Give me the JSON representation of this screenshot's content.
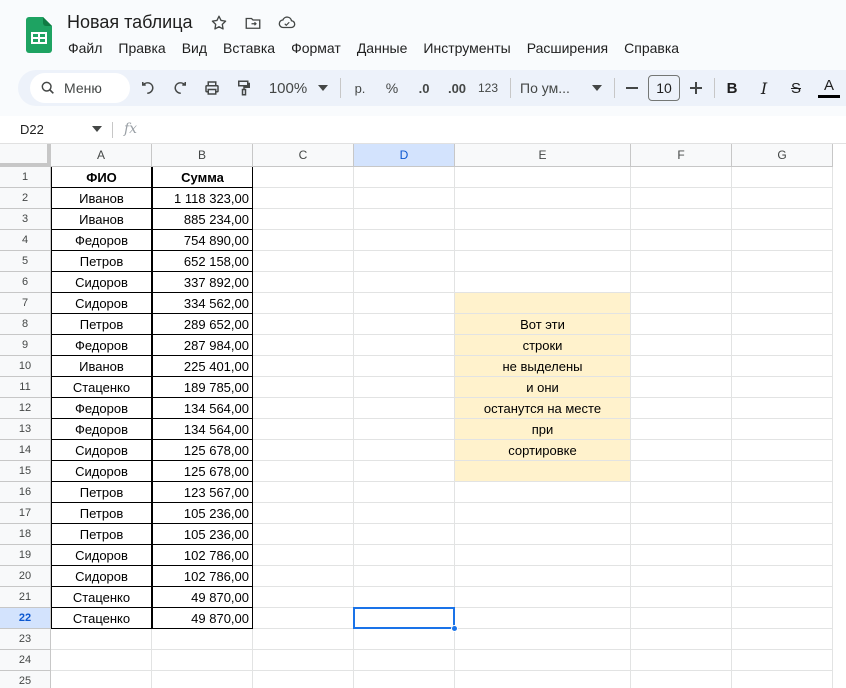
{
  "doc": {
    "title": "Новая таблица",
    "icons": [
      "star-icon",
      "move-to-folder-icon",
      "cloud-status-icon"
    ]
  },
  "menu": [
    "Файл",
    "Правка",
    "Вид",
    "Вставка",
    "Формат",
    "Данные",
    "Инструменты",
    "Расширения",
    "Справка"
  ],
  "toolbar": {
    "search_label": "Меню",
    "zoom": "100%",
    "currency": "р.",
    "percent": "%",
    "decrease_decimals": ".0",
    "increase_decimals": ".00",
    "number_format": "123",
    "font_name": "По ум...",
    "font_size": "10",
    "bold": "B",
    "italic": "I",
    "strike": "S",
    "text_color": "A"
  },
  "formula_bar": {
    "name_box": "D22",
    "fx": "fx",
    "content": ""
  },
  "columns": [
    "A",
    "B",
    "C",
    "D",
    "E",
    "F",
    "G"
  ],
  "active_column": "D",
  "active_row": 22,
  "rows": [
    "1",
    "2",
    "3",
    "4",
    "5",
    "6",
    "7",
    "8",
    "9",
    "10",
    "11",
    "12",
    "13",
    "14",
    "15",
    "16",
    "17",
    "18",
    "19",
    "20",
    "21",
    "22",
    "23",
    "24",
    "25"
  ],
  "table": {
    "header": {
      "name": "ФИО",
      "amount": "Сумма"
    },
    "data": [
      {
        "name": "Иванов",
        "amount": "1 118 323,00"
      },
      {
        "name": "Иванов",
        "amount": "885 234,00"
      },
      {
        "name": "Федоров",
        "amount": "754 890,00"
      },
      {
        "name": "Петров",
        "amount": "652 158,00"
      },
      {
        "name": "Сидоров",
        "amount": "337 892,00"
      },
      {
        "name": "Сидоров",
        "amount": "334 562,00"
      },
      {
        "name": "Петров",
        "amount": "289 652,00"
      },
      {
        "name": "Федоров",
        "amount": "287 984,00"
      },
      {
        "name": "Иванов",
        "amount": "225 401,00"
      },
      {
        "name": "Стаценко",
        "amount": "189 785,00"
      },
      {
        "name": "Федоров",
        "amount": "134 564,00"
      },
      {
        "name": "Федоров",
        "amount": "134 564,00"
      },
      {
        "name": "Сидоров",
        "amount": "125 678,00"
      },
      {
        "name": "Сидоров",
        "amount": "125 678,00"
      },
      {
        "name": "Петров",
        "amount": "123 567,00"
      },
      {
        "name": "Петров",
        "amount": "105 236,00"
      },
      {
        "name": "Петров",
        "amount": "105 236,00"
      },
      {
        "name": "Сидоров",
        "amount": "102 786,00"
      },
      {
        "name": "Сидоров",
        "amount": "102 786,00"
      },
      {
        "name": "Стаценко",
        "amount": "49 870,00"
      },
      {
        "name": "Стаценко",
        "amount": "49 870,00"
      }
    ]
  },
  "note": {
    "fill": "#fff2cc",
    "lines": [
      "",
      "Вот эти",
      "строки",
      "не выделены",
      "и они",
      "останутся на месте",
      "при",
      "сортировке",
      ""
    ]
  },
  "colors": {
    "accent": "#1a73e8",
    "header_active": "#d3e3fd",
    "toolbar_bg": "#edf2fa"
  }
}
